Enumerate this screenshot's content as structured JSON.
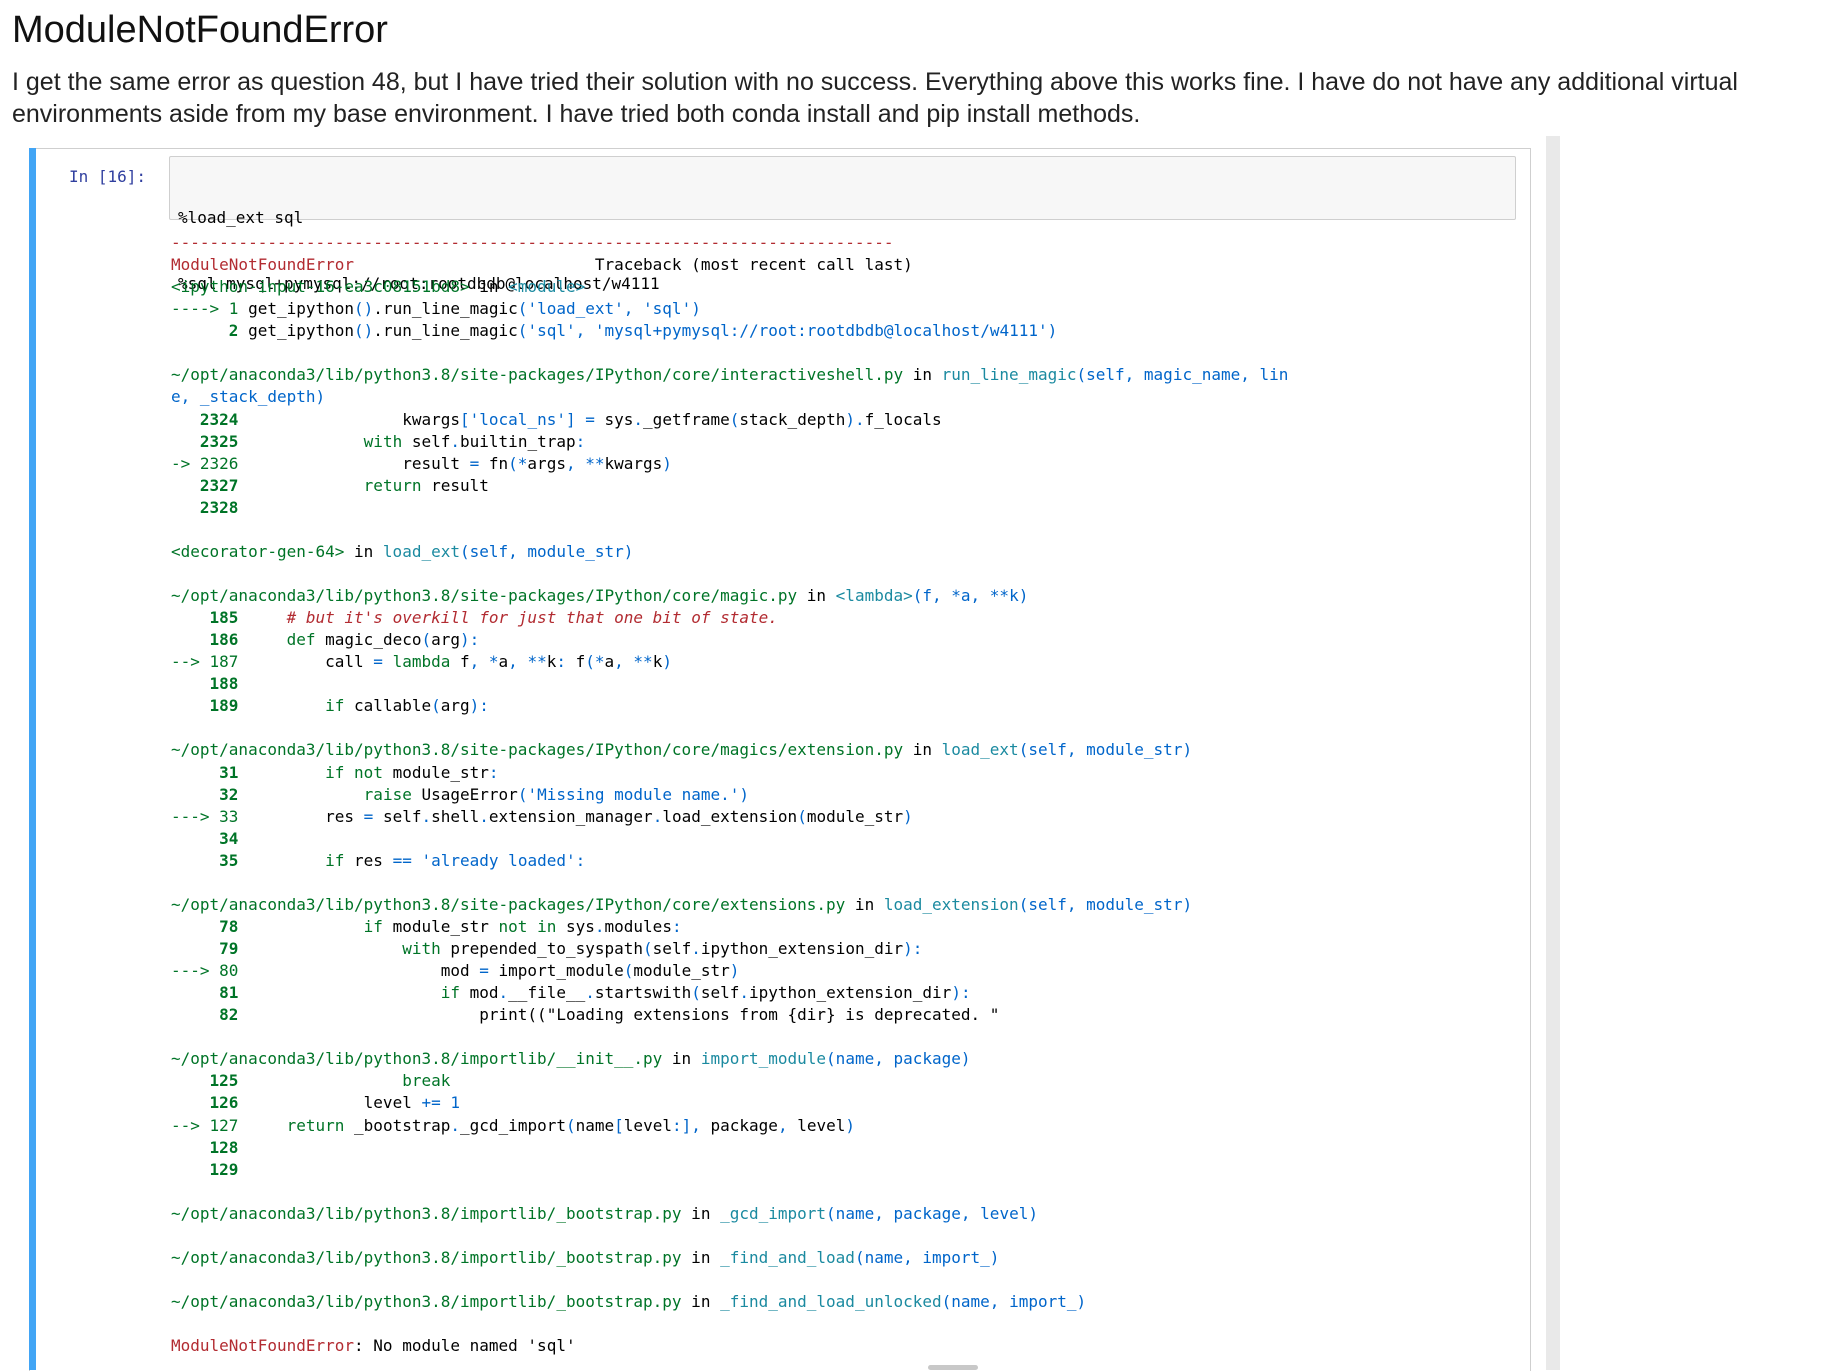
{
  "post": {
    "title": "ModuleNotFoundError",
    "body": "I get the same error as question 48, but I have tried their solution with no success. Everything above this works fine. I have do not have any additional virtual environments aside from my base environment. I have tried both conda install and pip install methods."
  },
  "cell": {
    "prompt": "In [16]:",
    "input_lines": [
      "%load_ext sql",
      "%sql mysql+pymysql://root:rootdbdb@localhost/w4111"
    ]
  },
  "traceback": [
    [
      {
        "t": "---------------------------------------------------------------------------",
        "c": "c-red"
      }
    ],
    [
      {
        "t": "ModuleNotFoundError",
        "c": "c-red"
      },
      {
        "t": "                         Traceback (most recent call last)",
        "c": ""
      }
    ],
    [
      {
        "t": "<ipython-input-16-ea3c08151bd8>",
        "c": "c-green"
      },
      {
        "t": " in ",
        "c": ""
      },
      {
        "t": "<module>",
        "c": "c-cyan"
      }
    ],
    [
      {
        "t": "----> 1 ",
        "c": "c-green"
      },
      {
        "t": "get_ipython",
        "c": ""
      },
      {
        "t": "()",
        "c": "c-blue"
      },
      {
        "t": ".",
        "c": ""
      },
      {
        "t": "run_line_magic",
        "c": ""
      },
      {
        "t": "(",
        "c": "c-blue"
      },
      {
        "t": "'load_ext'",
        "c": "c-blue"
      },
      {
        "t": ", ",
        "c": "c-blue"
      },
      {
        "t": "'sql'",
        "c": "c-blue"
      },
      {
        "t": ")",
        "c": "c-blue"
      }
    ],
    [
      {
        "t": "      2 ",
        "c": "c-green c-bold"
      },
      {
        "t": "get_ipython",
        "c": ""
      },
      {
        "t": "()",
        "c": "c-blue"
      },
      {
        "t": ".",
        "c": ""
      },
      {
        "t": "run_line_magic",
        "c": ""
      },
      {
        "t": "(",
        "c": "c-blue"
      },
      {
        "t": "'sql'",
        "c": "c-blue"
      },
      {
        "t": ", ",
        "c": "c-blue"
      },
      {
        "t": "'mysql+pymysql://root:rootdbdb@localhost/w4111'",
        "c": "c-blue"
      },
      {
        "t": ")",
        "c": "c-blue"
      }
    ],
    [],
    [
      {
        "t": "~/opt/anaconda3/lib/python3.8/site-packages/IPython/core/interactiveshell.py",
        "c": "c-green"
      },
      {
        "t": " in ",
        "c": ""
      },
      {
        "t": "run_line_magic",
        "c": "c-cyan"
      },
      {
        "t": "(self, magic_name, lin",
        "c": "c-blue"
      }
    ],
    [
      {
        "t": "e, _stack_depth)",
        "c": "c-blue"
      }
    ],
    [
      {
        "t": "   2324",
        "c": "c-green c-bold"
      },
      {
        "t": "                 kwargs",
        "c": ""
      },
      {
        "t": "[",
        "c": "c-blue"
      },
      {
        "t": "'local_ns'",
        "c": "c-blue"
      },
      {
        "t": "] = ",
        "c": "c-blue"
      },
      {
        "t": "sys",
        "c": ""
      },
      {
        "t": ".",
        "c": "c-blue"
      },
      {
        "t": "_getframe",
        "c": ""
      },
      {
        "t": "(",
        "c": "c-blue"
      },
      {
        "t": "stack_depth",
        "c": ""
      },
      {
        "t": ").",
        "c": "c-blue"
      },
      {
        "t": "f_locals",
        "c": ""
      }
    ],
    [
      {
        "t": "   2325",
        "c": "c-green c-bold"
      },
      {
        "t": "             ",
        "c": ""
      },
      {
        "t": "with",
        "c": "c-green"
      },
      {
        "t": " self",
        "c": ""
      },
      {
        "t": ".",
        "c": "c-blue"
      },
      {
        "t": "builtin_trap",
        "c": ""
      },
      {
        "t": ":",
        "c": "c-blue"
      }
    ],
    [
      {
        "t": "-> 2326",
        "c": "c-green"
      },
      {
        "t": "                 result ",
        "c": ""
      },
      {
        "t": "= ",
        "c": "c-blue"
      },
      {
        "t": "fn",
        "c": ""
      },
      {
        "t": "(*",
        "c": "c-blue"
      },
      {
        "t": "args",
        "c": ""
      },
      {
        "t": ", **",
        "c": "c-blue"
      },
      {
        "t": "kwargs",
        "c": ""
      },
      {
        "t": ")",
        "c": "c-blue"
      }
    ],
    [
      {
        "t": "   2327",
        "c": "c-green c-bold"
      },
      {
        "t": "             ",
        "c": ""
      },
      {
        "t": "return",
        "c": "c-green"
      },
      {
        "t": " result",
        "c": ""
      }
    ],
    [
      {
        "t": "   2328",
        "c": "c-green c-bold"
      }
    ],
    [],
    [
      {
        "t": "<decorator-gen-64>",
        "c": "c-green"
      },
      {
        "t": " in ",
        "c": ""
      },
      {
        "t": "load_ext",
        "c": "c-cyan"
      },
      {
        "t": "(self, module_str)",
        "c": "c-blue"
      }
    ],
    [],
    [
      {
        "t": "~/opt/anaconda3/lib/python3.8/site-packages/IPython/core/magic.py",
        "c": "c-green"
      },
      {
        "t": " in ",
        "c": ""
      },
      {
        "t": "<lambda>",
        "c": "c-cyan"
      },
      {
        "t": "(f, *a, **k)",
        "c": "c-blue"
      }
    ],
    [
      {
        "t": "    185",
        "c": "c-green c-bold"
      },
      {
        "t": "     ",
        "c": ""
      },
      {
        "t": "# but it's overkill for just that one bit of state.",
        "c": "c-comment"
      }
    ],
    [
      {
        "t": "    186",
        "c": "c-green c-bold"
      },
      {
        "t": "     ",
        "c": ""
      },
      {
        "t": "def",
        "c": "c-green"
      },
      {
        "t": " magic_deco",
        "c": ""
      },
      {
        "t": "(",
        "c": "c-blue"
      },
      {
        "t": "arg",
        "c": ""
      },
      {
        "t": "):",
        "c": "c-blue"
      }
    ],
    [
      {
        "t": "--> 187",
        "c": "c-green"
      },
      {
        "t": "         call ",
        "c": ""
      },
      {
        "t": "= ",
        "c": "c-blue"
      },
      {
        "t": "lambda",
        "c": "c-green"
      },
      {
        "t": " f",
        "c": ""
      },
      {
        "t": ", *",
        "c": "c-blue"
      },
      {
        "t": "a",
        "c": ""
      },
      {
        "t": ", **",
        "c": "c-blue"
      },
      {
        "t": "k",
        "c": ""
      },
      {
        "t": ": ",
        "c": "c-blue"
      },
      {
        "t": "f",
        "c": ""
      },
      {
        "t": "(*",
        "c": "c-blue"
      },
      {
        "t": "a",
        "c": ""
      },
      {
        "t": ", **",
        "c": "c-blue"
      },
      {
        "t": "k",
        "c": ""
      },
      {
        "t": ")",
        "c": "c-blue"
      }
    ],
    [
      {
        "t": "    188",
        "c": "c-green c-bold"
      }
    ],
    [
      {
        "t": "    189",
        "c": "c-green c-bold"
      },
      {
        "t": "         ",
        "c": ""
      },
      {
        "t": "if",
        "c": "c-green"
      },
      {
        "t": " callable",
        "c": ""
      },
      {
        "t": "(",
        "c": "c-blue"
      },
      {
        "t": "arg",
        "c": ""
      },
      {
        "t": "):",
        "c": "c-blue"
      }
    ],
    [],
    [
      {
        "t": "~/opt/anaconda3/lib/python3.8/site-packages/IPython/core/magics/extension.py",
        "c": "c-green"
      },
      {
        "t": " in ",
        "c": ""
      },
      {
        "t": "load_ext",
        "c": "c-cyan"
      },
      {
        "t": "(self, module_str)",
        "c": "c-blue"
      }
    ],
    [
      {
        "t": "     31",
        "c": "c-green c-bold"
      },
      {
        "t": "         ",
        "c": ""
      },
      {
        "t": "if",
        "c": "c-green"
      },
      {
        "t": " ",
        "c": ""
      },
      {
        "t": "not",
        "c": "c-green"
      },
      {
        "t": " module_str",
        "c": ""
      },
      {
        "t": ":",
        "c": "c-blue"
      }
    ],
    [
      {
        "t": "     32",
        "c": "c-green c-bold"
      },
      {
        "t": "             ",
        "c": ""
      },
      {
        "t": "raise",
        "c": "c-green"
      },
      {
        "t": " UsageError",
        "c": ""
      },
      {
        "t": "(",
        "c": "c-blue"
      },
      {
        "t": "'Missing module name.'",
        "c": "c-blue"
      },
      {
        "t": ")",
        "c": "c-blue"
      }
    ],
    [
      {
        "t": "---> 33",
        "c": "c-green"
      },
      {
        "t": "         res ",
        "c": ""
      },
      {
        "t": "= ",
        "c": "c-blue"
      },
      {
        "t": "self",
        "c": ""
      },
      {
        "t": ".",
        "c": "c-blue"
      },
      {
        "t": "shell",
        "c": ""
      },
      {
        "t": ".",
        "c": "c-blue"
      },
      {
        "t": "extension_manager",
        "c": ""
      },
      {
        "t": ".",
        "c": "c-blue"
      },
      {
        "t": "load_extension",
        "c": ""
      },
      {
        "t": "(",
        "c": "c-blue"
      },
      {
        "t": "module_str",
        "c": ""
      },
      {
        "t": ")",
        "c": "c-blue"
      }
    ],
    [
      {
        "t": "     34",
        "c": "c-green c-bold"
      }
    ],
    [
      {
        "t": "     35",
        "c": "c-green c-bold"
      },
      {
        "t": "         ",
        "c": ""
      },
      {
        "t": "if",
        "c": "c-green"
      },
      {
        "t": " res ",
        "c": ""
      },
      {
        "t": "== ",
        "c": "c-blue"
      },
      {
        "t": "'already loaded'",
        "c": "c-blue"
      },
      {
        "t": ":",
        "c": "c-blue"
      }
    ],
    [],
    [
      {
        "t": "~/opt/anaconda3/lib/python3.8/site-packages/IPython/core/extensions.py",
        "c": "c-green"
      },
      {
        "t": " in ",
        "c": ""
      },
      {
        "t": "load_extension",
        "c": "c-cyan"
      },
      {
        "t": "(self, module_str)",
        "c": "c-blue"
      }
    ],
    [
      {
        "t": "     78",
        "c": "c-green c-bold"
      },
      {
        "t": "             ",
        "c": ""
      },
      {
        "t": "if",
        "c": "c-green"
      },
      {
        "t": " module_str ",
        "c": ""
      },
      {
        "t": "not",
        "c": "c-green"
      },
      {
        "t": " ",
        "c": ""
      },
      {
        "t": "in",
        "c": "c-green"
      },
      {
        "t": " sys",
        "c": ""
      },
      {
        "t": ".",
        "c": "c-blue"
      },
      {
        "t": "modules",
        "c": ""
      },
      {
        "t": ":",
        "c": "c-blue"
      }
    ],
    [
      {
        "t": "     79",
        "c": "c-green c-bold"
      },
      {
        "t": "                 ",
        "c": ""
      },
      {
        "t": "with",
        "c": "c-green"
      },
      {
        "t": " prepended_to_syspath",
        "c": ""
      },
      {
        "t": "(",
        "c": "c-blue"
      },
      {
        "t": "self",
        "c": ""
      },
      {
        "t": ".",
        "c": "c-blue"
      },
      {
        "t": "ipython_extension_dir",
        "c": ""
      },
      {
        "t": "):",
        "c": "c-blue"
      }
    ],
    [
      {
        "t": "---> 80",
        "c": "c-green"
      },
      {
        "t": "                     mod ",
        "c": ""
      },
      {
        "t": "= ",
        "c": "c-blue"
      },
      {
        "t": "import_module",
        "c": ""
      },
      {
        "t": "(",
        "c": "c-blue"
      },
      {
        "t": "module_str",
        "c": ""
      },
      {
        "t": ")",
        "c": "c-blue"
      }
    ],
    [
      {
        "t": "     81",
        "c": "c-green c-bold"
      },
      {
        "t": "                     ",
        "c": ""
      },
      {
        "t": "if",
        "c": "c-green"
      },
      {
        "t": " mod",
        "c": ""
      },
      {
        "t": ".",
        "c": "c-blue"
      },
      {
        "t": "__file__",
        "c": ""
      },
      {
        "t": ".",
        "c": "c-blue"
      },
      {
        "t": "startswith",
        "c": ""
      },
      {
        "t": "(",
        "c": "c-blue"
      },
      {
        "t": "self",
        "c": ""
      },
      {
        "t": ".",
        "c": "c-blue"
      },
      {
        "t": "ipython_extension_dir",
        "c": ""
      },
      {
        "t": "):",
        "c": "c-blue"
      }
    ],
    [
      {
        "t": "     82",
        "c": "c-green c-bold"
      },
      {
        "t": "                         print((\"Loading extensions from {dir} is deprecated. \"",
        "c": ""
      }
    ],
    [],
    [
      {
        "t": "~/opt/anaconda3/lib/python3.8/importlib/__init__.py",
        "c": "c-green"
      },
      {
        "t": " in ",
        "c": ""
      },
      {
        "t": "import_module",
        "c": "c-cyan"
      },
      {
        "t": "(name, package)",
        "c": "c-blue"
      }
    ],
    [
      {
        "t": "    125",
        "c": "c-green c-bold"
      },
      {
        "t": "                 ",
        "c": ""
      },
      {
        "t": "break",
        "c": "c-green"
      }
    ],
    [
      {
        "t": "    126",
        "c": "c-green c-bold"
      },
      {
        "t": "             level ",
        "c": ""
      },
      {
        "t": "+= ",
        "c": "c-blue"
      },
      {
        "t": "1",
        "c": "c-blue"
      }
    ],
    [
      {
        "t": "--> 127",
        "c": "c-green"
      },
      {
        "t": "     ",
        "c": ""
      },
      {
        "t": "return",
        "c": "c-green"
      },
      {
        "t": " _bootstrap",
        "c": ""
      },
      {
        "t": ".",
        "c": "c-blue"
      },
      {
        "t": "_gcd_import",
        "c": ""
      },
      {
        "t": "(",
        "c": "c-blue"
      },
      {
        "t": "name",
        "c": ""
      },
      {
        "t": "[",
        "c": "c-blue"
      },
      {
        "t": "level",
        "c": ""
      },
      {
        "t": ":], ",
        "c": "c-blue"
      },
      {
        "t": "package",
        "c": ""
      },
      {
        "t": ", ",
        "c": "c-blue"
      },
      {
        "t": "level",
        "c": ""
      },
      {
        "t": ")",
        "c": "c-blue"
      }
    ],
    [
      {
        "t": "    128",
        "c": "c-green c-bold"
      }
    ],
    [
      {
        "t": "    129",
        "c": "c-green c-bold"
      }
    ],
    [],
    [
      {
        "t": "~/opt/anaconda3/lib/python3.8/importlib/_bootstrap.py",
        "c": "c-green"
      },
      {
        "t": " in ",
        "c": ""
      },
      {
        "t": "_gcd_import",
        "c": "c-cyan"
      },
      {
        "t": "(name, package, level)",
        "c": "c-blue"
      }
    ],
    [],
    [
      {
        "t": "~/opt/anaconda3/lib/python3.8/importlib/_bootstrap.py",
        "c": "c-green"
      },
      {
        "t": " in ",
        "c": ""
      },
      {
        "t": "_find_and_load",
        "c": "c-cyan"
      },
      {
        "t": "(name, import_)",
        "c": "c-blue"
      }
    ],
    [],
    [
      {
        "t": "~/opt/anaconda3/lib/python3.8/importlib/_bootstrap.py",
        "c": "c-green"
      },
      {
        "t": " in ",
        "c": ""
      },
      {
        "t": "_find_and_load_unlocked",
        "c": "c-cyan"
      },
      {
        "t": "(name, import_)",
        "c": "c-blue"
      }
    ],
    [],
    [
      {
        "t": "ModuleNotFoundError",
        "c": "c-red"
      },
      {
        "t": ": No module named 'sql'",
        "c": ""
      }
    ]
  ]
}
